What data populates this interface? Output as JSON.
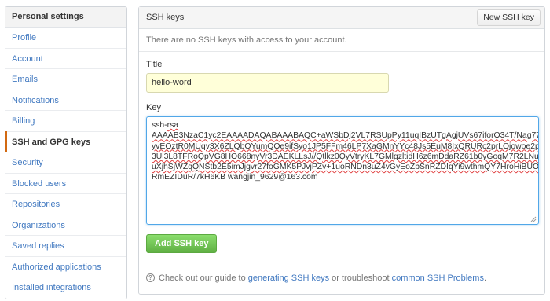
{
  "sidebar": {
    "header": "Personal settings",
    "items": [
      {
        "label": "Profile"
      },
      {
        "label": "Account"
      },
      {
        "label": "Emails"
      },
      {
        "label": "Notifications"
      },
      {
        "label": "Billing"
      },
      {
        "label": "SSH and GPG keys",
        "selected": true
      },
      {
        "label": "Security"
      },
      {
        "label": "Blocked users"
      },
      {
        "label": "Repositories"
      },
      {
        "label": "Organizations"
      },
      {
        "label": "Saved replies"
      },
      {
        "label": "Authorized applications"
      },
      {
        "label": "Installed integrations"
      }
    ]
  },
  "panel": {
    "title": "SSH keys",
    "new_key_button": "New SSH key",
    "empty_message": "There are no SSH keys with access to your account."
  },
  "form": {
    "title_label": "Title",
    "title_value": "hello-word",
    "key_label": "Key",
    "key_lines": [
      "ssh-rsa",
      "AAAAB3NzaC1yc2EAAAADAQABAAABAQC+aWSbDj2VL7RSUpPy11uqIBzUTgAgjUVs67iforO34T/Nag77I93yHO7",
      "yvEOztR0MUqv3X6ZLQbOYumQOe9ifSyo1JP5FFm46LP7XaGMnYYc48Js5EuM8IxQRURc2prLOjowoe2prLOseStSB",
      "3Ul3L8TFRoQpVG8HO668nyVr3DAEKLLsJ//Qtlkz0QyVtryKL7GMlgzltidH6z6mDdaRZ61b0yGoqM7R2LNuUgtLWfp",
      "uXjhSjWZqQNStb2E5imJjgvr27foGMK5PJvjPZv+1uoRNDn3uZ4vGyEoZbSnRZDIqYi9wthmQY7HroHiBUOTZPTFMz",
      "RmEZIDuR/7kH6KB wangjin_9629@163.com"
    ],
    "add_button": "Add SSH key"
  },
  "footer": {
    "prefix": "Check out our guide to ",
    "guide_link": "generating SSH keys",
    "middle": " or troubleshoot ",
    "problems_link": "common SSH Problems",
    "suffix": "."
  },
  "colors": {
    "link": "#4078c0",
    "selected_marker": "#d26911",
    "add_button": "#60b044",
    "title_input_bg": "#ffffd9",
    "focus_border": "#51a7e8"
  }
}
